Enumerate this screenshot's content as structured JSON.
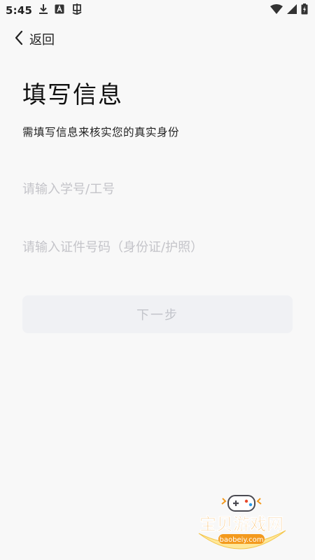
{
  "status_bar": {
    "time": "5:45",
    "left_icons": [
      "download-icon",
      "app-a-icon",
      "bug-icon"
    ],
    "right_icons": [
      "wifi-icon",
      "signal-icon",
      "battery-charging-icon"
    ]
  },
  "nav": {
    "back_label": "返回"
  },
  "page": {
    "title": "填写信息",
    "subtitle": "需填写信息来核实您的真实身份"
  },
  "form": {
    "id_field": {
      "value": "",
      "placeholder": "请输入学号/工号"
    },
    "cert_field": {
      "value": "",
      "placeholder": "请输入证件号码（身份证/护照）"
    },
    "next_label": "下一步"
  },
  "watermark": {
    "name": "宝贝游戏网",
    "url": "baobeiy.com"
  },
  "colors": {
    "background": "#f8f8f8",
    "placeholder": "#c4c4c9",
    "button_bg": "#f0f1f4",
    "button_text": "#c2c4ca",
    "watermark_orange": "#f39a1e"
  }
}
